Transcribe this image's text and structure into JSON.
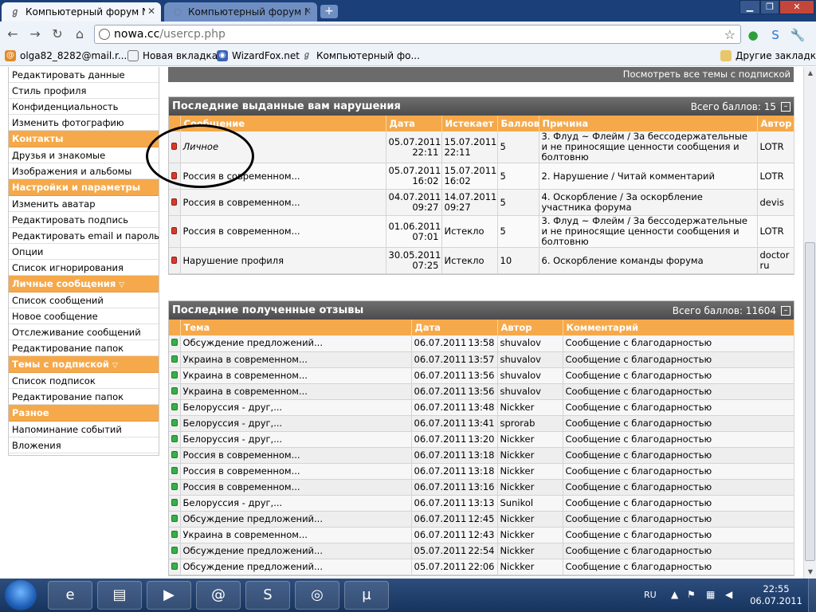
{
  "browser": {
    "tabs": [
      {
        "title": "Компьютерный форум No",
        "active": true
      },
      {
        "title": "Компьютерный форум No",
        "active": false
      }
    ],
    "url_host": "nowa.cc",
    "url_path": "/usercp.php",
    "bookmarks": [
      "olga82_8282@mail.r...",
      "Новая вкладка",
      "WizardFox.net",
      "Компьютерный фо..."
    ],
    "other_bookmarks": "Другие закладки"
  },
  "sidebar": {
    "top_items": [
      "Редактировать данные",
      "Стиль профиля",
      "Конфиденциальность",
      "Изменить фотографию"
    ],
    "groups": [
      {
        "title": "Контакты",
        "items": [
          "Друзья и знакомые",
          "Изображения и альбомы"
        ]
      },
      {
        "title": "Настройки и параметры",
        "items": [
          "Изменить аватар",
          "Редактировать подпись",
          "Редактировать email и пароль",
          "Опции",
          "Список игнорирования"
        ]
      },
      {
        "title": "Личные сообщения",
        "items": [
          "Список сообщений",
          "Новое сообщение",
          "Отслеживание сообщений",
          "Редактирование папок"
        ]
      },
      {
        "title": "Темы с подпиской",
        "items": [
          "Список подписок",
          "Редактирование папок"
        ]
      },
      {
        "title": "Разное",
        "items": [
          "Напоминание событий",
          "Вложения"
        ]
      }
    ]
  },
  "subscriptions_link": "Посмотреть все темы с подпиской",
  "violations": {
    "title": "Последние выданные вам нарушения",
    "total": "Всего баллов: 15",
    "columns": [
      "Сообщение",
      "Дата",
      "Истекает",
      "Баллов",
      "Причина",
      "Автор"
    ],
    "rows": [
      {
        "message": "Личное",
        "date": "05.07.2011",
        "time": "22:11",
        "expires": "15.07.2011",
        "expires_time": "22:11",
        "points": "5",
        "reason": "3. Флуд ~ Флейм / За бессодержательные и не приносящие ценности сообщения и болтовню",
        "author": "LOTR"
      },
      {
        "message": "Россия в современном...",
        "date": "05.07.2011",
        "time": "16:02",
        "expires": "15.07.2011",
        "expires_time": "16:02",
        "points": "5",
        "reason": "2. Нарушение / Читай комментарий",
        "author": "LOTR"
      },
      {
        "message": "Россия в современном...",
        "date": "04.07.2011",
        "time": "09:27",
        "expires": "14.07.2011",
        "expires_time": "09:27",
        "points": "5",
        "reason": "4. Оскорбление / За оскорбление участника форума",
        "author": "devis"
      },
      {
        "message": "Россия в современном...",
        "date": "01.06.2011",
        "time": "07:01",
        "expires": "Истекло",
        "expires_time": "",
        "points": "5",
        "reason": "3. Флуд ~ Флейм / За бессодержательные и не приносящие ценности сообщения и болтовню",
        "author": "LOTR"
      },
      {
        "message": "Нарушение профиля",
        "date": "30.05.2011",
        "time": "07:25",
        "expires": "Истекло",
        "expires_time": "",
        "points": "10",
        "reason": "6. Оскорбление команды форума",
        "author": "doctor ru"
      }
    ]
  },
  "feedback": {
    "title": "Последние полученные отзывы",
    "total": "Всего баллов: 11604",
    "columns": [
      "Тема",
      "Дата",
      "Автор",
      "Комментарий"
    ],
    "rows": [
      {
        "topic": "Обсуждение предложений...",
        "date": "06.07.2011",
        "time": "13:58",
        "author": "shuvalov",
        "comment": "Сообщение с благодарностью"
      },
      {
        "topic": "Украина в современном...",
        "date": "06.07.2011",
        "time": "13:57",
        "author": "shuvalov",
        "comment": "Сообщение с благодарностью"
      },
      {
        "topic": "Украина в современном...",
        "date": "06.07.2011",
        "time": "13:56",
        "author": "shuvalov",
        "comment": "Сообщение с благодарностью"
      },
      {
        "topic": "Украина в современном...",
        "date": "06.07.2011",
        "time": "13:56",
        "author": "shuvalov",
        "comment": "Сообщение с благодарностью"
      },
      {
        "topic": "Белоруссия - друг,...",
        "date": "06.07.2011",
        "time": "13:48",
        "author": "Nickker",
        "comment": "Сообщение с благодарностью"
      },
      {
        "topic": "Белоруссия - друг,...",
        "date": "06.07.2011",
        "time": "13:41",
        "author": "sprorab",
        "comment": "Сообщение с благодарностью"
      },
      {
        "topic": "Белоруссия - друг,...",
        "date": "06.07.2011",
        "time": "13:20",
        "author": "Nickker",
        "comment": "Сообщение с благодарностью"
      },
      {
        "topic": "Россия в современном...",
        "date": "06.07.2011",
        "time": "13:18",
        "author": "Nickker",
        "comment": "Сообщение с благодарностью"
      },
      {
        "topic": "Россия в современном...",
        "date": "06.07.2011",
        "time": "13:18",
        "author": "Nickker",
        "comment": "Сообщение с благодарностью"
      },
      {
        "topic": "Россия в современном...",
        "date": "06.07.2011",
        "time": "13:16",
        "author": "Nickker",
        "comment": "Сообщение с благодарностью"
      },
      {
        "topic": "Белоруссия - друг,...",
        "date": "06.07.2011",
        "time": "13:13",
        "author": "Sunikol",
        "comment": "Сообщение с благодарностью"
      },
      {
        "topic": "Обсуждение предложений...",
        "date": "06.07.2011",
        "time": "12:45",
        "author": "Nickker",
        "comment": "Сообщение с благодарностью"
      },
      {
        "topic": "Украина в современном...",
        "date": "06.07.2011",
        "time": "12:43",
        "author": "Nickker",
        "comment": "Сообщение с благодарностью"
      },
      {
        "topic": "Обсуждение предложений...",
        "date": "05.07.2011",
        "time": "22:54",
        "author": "Nickker",
        "comment": "Сообщение с благодарностью"
      },
      {
        "topic": "Обсуждение предложений...",
        "date": "05.07.2011",
        "time": "22:06",
        "author": "Nickker",
        "comment": "Сообщение с благодарностью"
      }
    ]
  },
  "taskbar": {
    "lang": "RU",
    "time": "22:55",
    "date": "06.07.2011"
  },
  "colors": {
    "accent": "#f5a94a",
    "header": "#5b5b5b",
    "violation": "#d93a2c",
    "feedback": "#36b04a"
  }
}
